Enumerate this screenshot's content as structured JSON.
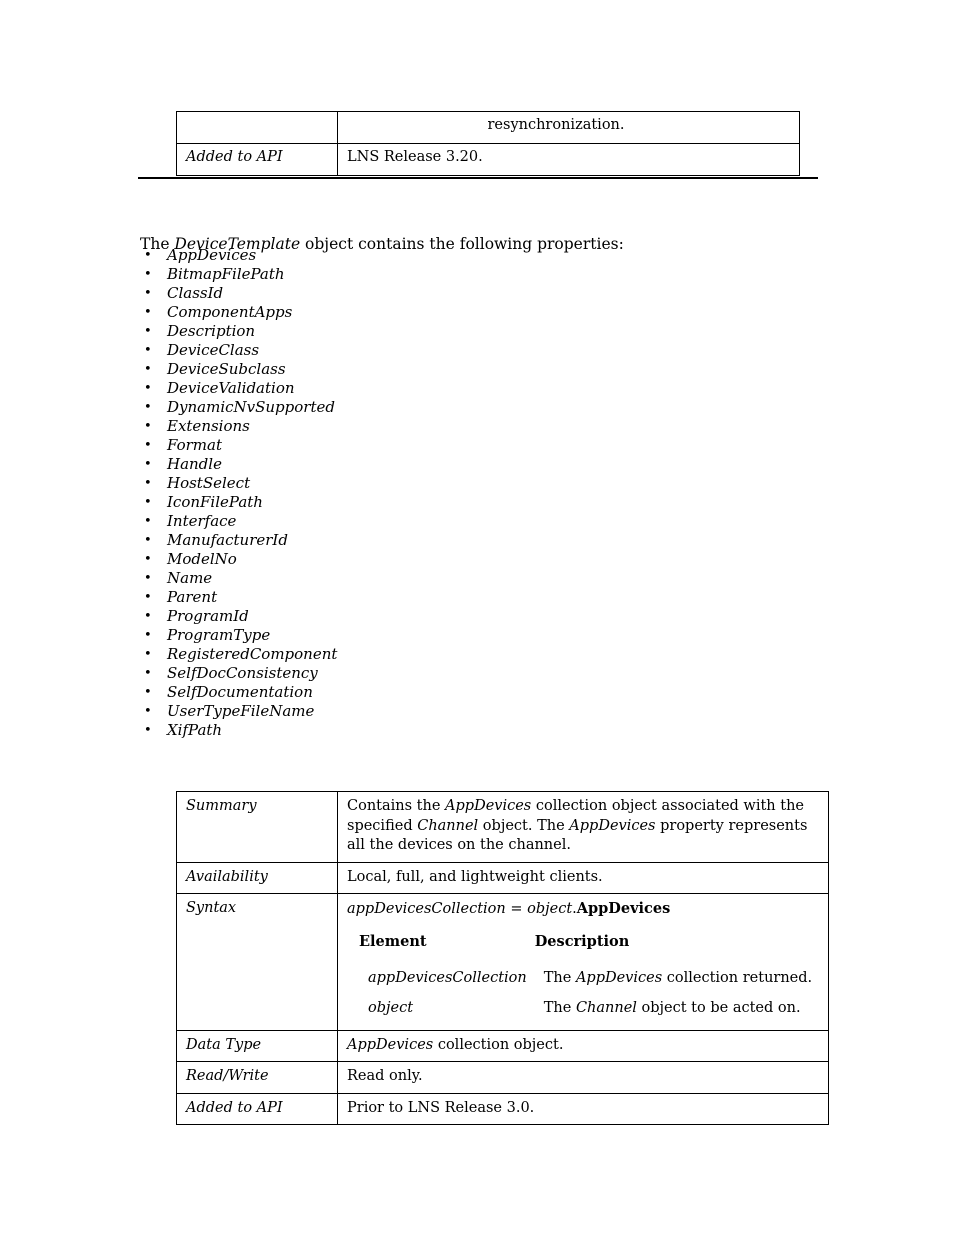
{
  "top_table": {
    "rows": [
      {
        "label": "",
        "value": "resynchronization.",
        "continued": true
      },
      {
        "label": "Added to API",
        "value": "LNS Release 3.20."
      }
    ]
  },
  "intro": {
    "before": "The ",
    "object_name": "DeviceTemplate",
    "after": " object contains the following properties:"
  },
  "properties": [
    "AppDevices",
    "BitmapFilePath",
    "ClassId",
    "ComponentApps",
    "Description",
    "DeviceClass",
    "DeviceSubclass",
    "DeviceValidation",
    "DynamicNvSupported",
    "Extensions",
    "Format",
    "Handle",
    "HostSelect",
    "IconFilePath",
    "Interface",
    "ManufacturerId",
    "ModelNo",
    "Name",
    "Parent",
    "ProgramId",
    "ProgramType",
    "RegisteredComponent",
    "SelfDocConsistency",
    "SelfDocumentation",
    "UserTypeFileName",
    "XifPath"
  ],
  "bullet_glyph": "•",
  "main_table": {
    "summary": {
      "label": "Summary",
      "text_part_1": "Contains the ",
      "em_1": "AppDevices",
      "text_part_2": " collection object associated with the specified ",
      "em_2": "Channel",
      "text_part_3": " object. The ",
      "em_3": "AppDevices",
      "text_part_4": " property represents all the devices on the channel."
    },
    "availability": {
      "label": "Availability",
      "value": "Local, full, and lightweight clients."
    },
    "syntax": {
      "label": "Syntax",
      "expression_lhs": "appDevicesCollection",
      "expression_eq": " = ",
      "expression_obj": "object",
      "expression_dot": ".",
      "expression_prop": "AppDevices",
      "element_header": "Element",
      "description_header": "Description",
      "rows": [
        {
          "element": "appDevicesCollection",
          "desc_part_1": "The ",
          "desc_em": "AppDevices",
          "desc_part_2": " collection returned."
        },
        {
          "element": "object",
          "desc_part_1": "The ",
          "desc_em": "Channel",
          "desc_part_2": " object to be acted on."
        }
      ]
    },
    "data_type": {
      "label": "Data Type",
      "em": "AppDevices",
      "text": " collection object."
    },
    "read_write": {
      "label": "Read/Write",
      "value": "Read only."
    },
    "added_to_api": {
      "label": "Added to API",
      "value": "Prior to LNS Release 3.0."
    }
  }
}
